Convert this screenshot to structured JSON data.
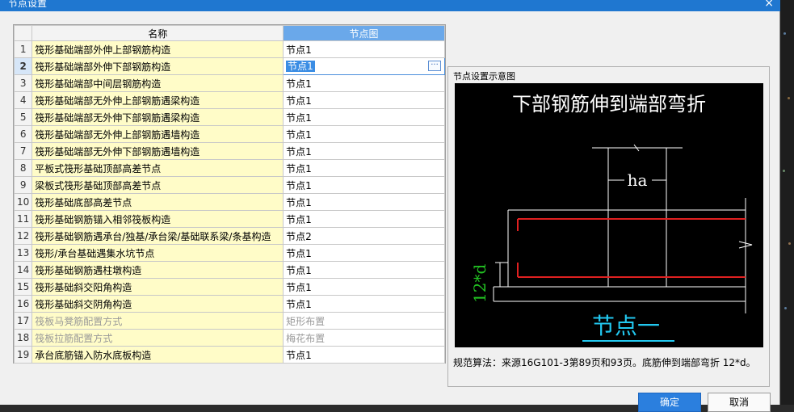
{
  "window": {
    "title": "节点设置",
    "close_glyph": "×"
  },
  "table": {
    "headers": {
      "name": "名称",
      "diagram": "节点图"
    },
    "selected_row": 2,
    "rows": [
      {
        "num": "1",
        "name": "筏形基础端部外伸上部钢筋构造",
        "value": "节点1",
        "grey": false
      },
      {
        "num": "2",
        "name": "筏形基础端部外伸下部钢筋构造",
        "value": "节点1",
        "grey": false
      },
      {
        "num": "3",
        "name": "筏形基础端部中间层钢筋构造",
        "value": "节点1",
        "grey": false
      },
      {
        "num": "4",
        "name": "筏形基础端部无外伸上部钢筋遇梁构造",
        "value": "节点1",
        "grey": false
      },
      {
        "num": "5",
        "name": "筏形基础端部无外伸下部钢筋遇梁构造",
        "value": "节点1",
        "grey": false
      },
      {
        "num": "6",
        "name": "筏形基础端部无外伸上部钢筋遇墙构造",
        "value": "节点1",
        "grey": false
      },
      {
        "num": "7",
        "name": "筏形基础端部无外伸下部钢筋遇墙构造",
        "value": "节点1",
        "grey": false
      },
      {
        "num": "8",
        "name": "平板式筏形基础顶部高差节点",
        "value": "节点1",
        "grey": false
      },
      {
        "num": "9",
        "name": "梁板式筏形基础顶部高差节点",
        "value": "节点1",
        "grey": false
      },
      {
        "num": "10",
        "name": "筏形基础底部高差节点",
        "value": "节点1",
        "grey": false
      },
      {
        "num": "11",
        "name": "筏形基础钢筋锚入相邻筏板构造",
        "value": "节点1",
        "grey": false
      },
      {
        "num": "12",
        "name": "筏形基础钢筋遇承台/独基/承台梁/基础联系梁/条基构造",
        "value": "节点2",
        "grey": false
      },
      {
        "num": "13",
        "name": "筏形/承台基础遇集水坑节点",
        "value": "节点1",
        "grey": false
      },
      {
        "num": "14",
        "name": "筏形基础钢筋遇柱墩构造",
        "value": "节点1",
        "grey": false
      },
      {
        "num": "15",
        "name": "筏形基础斜交阳角构造",
        "value": "节点1",
        "grey": false
      },
      {
        "num": "16",
        "name": "筏形基础斜交阴角构造",
        "value": "节点1",
        "grey": false
      },
      {
        "num": "17",
        "name": "筏板马凳筋配置方式",
        "value": "矩形布置",
        "grey": true
      },
      {
        "num": "18",
        "name": "筏板拉筋配置方式",
        "value": "梅花布置",
        "grey": true
      },
      {
        "num": "19",
        "name": "承台底筋锚入防水底板构造",
        "value": "节点1",
        "grey": false
      }
    ]
  },
  "preview": {
    "label": "节点设置示意图",
    "diagram_title": "下部钢筋伸到端部弯折",
    "dim_ha": "ha",
    "dim_12d": "12*d",
    "node_label": "节点一",
    "note": "规范算法：来源16G101-3第89页和93页。底筋伸到端部弯折 12*d。"
  },
  "buttons": {
    "ok": "确定",
    "cancel": "取消"
  },
  "colors": {
    "title_bar": "#1f77d0",
    "rebar": "#e02020",
    "dim_text_green": "#22c322",
    "node_label_cyan": "#22c8f0"
  },
  "icons": {
    "ellipsis": "ellipsis-icon",
    "close": "close-icon"
  }
}
